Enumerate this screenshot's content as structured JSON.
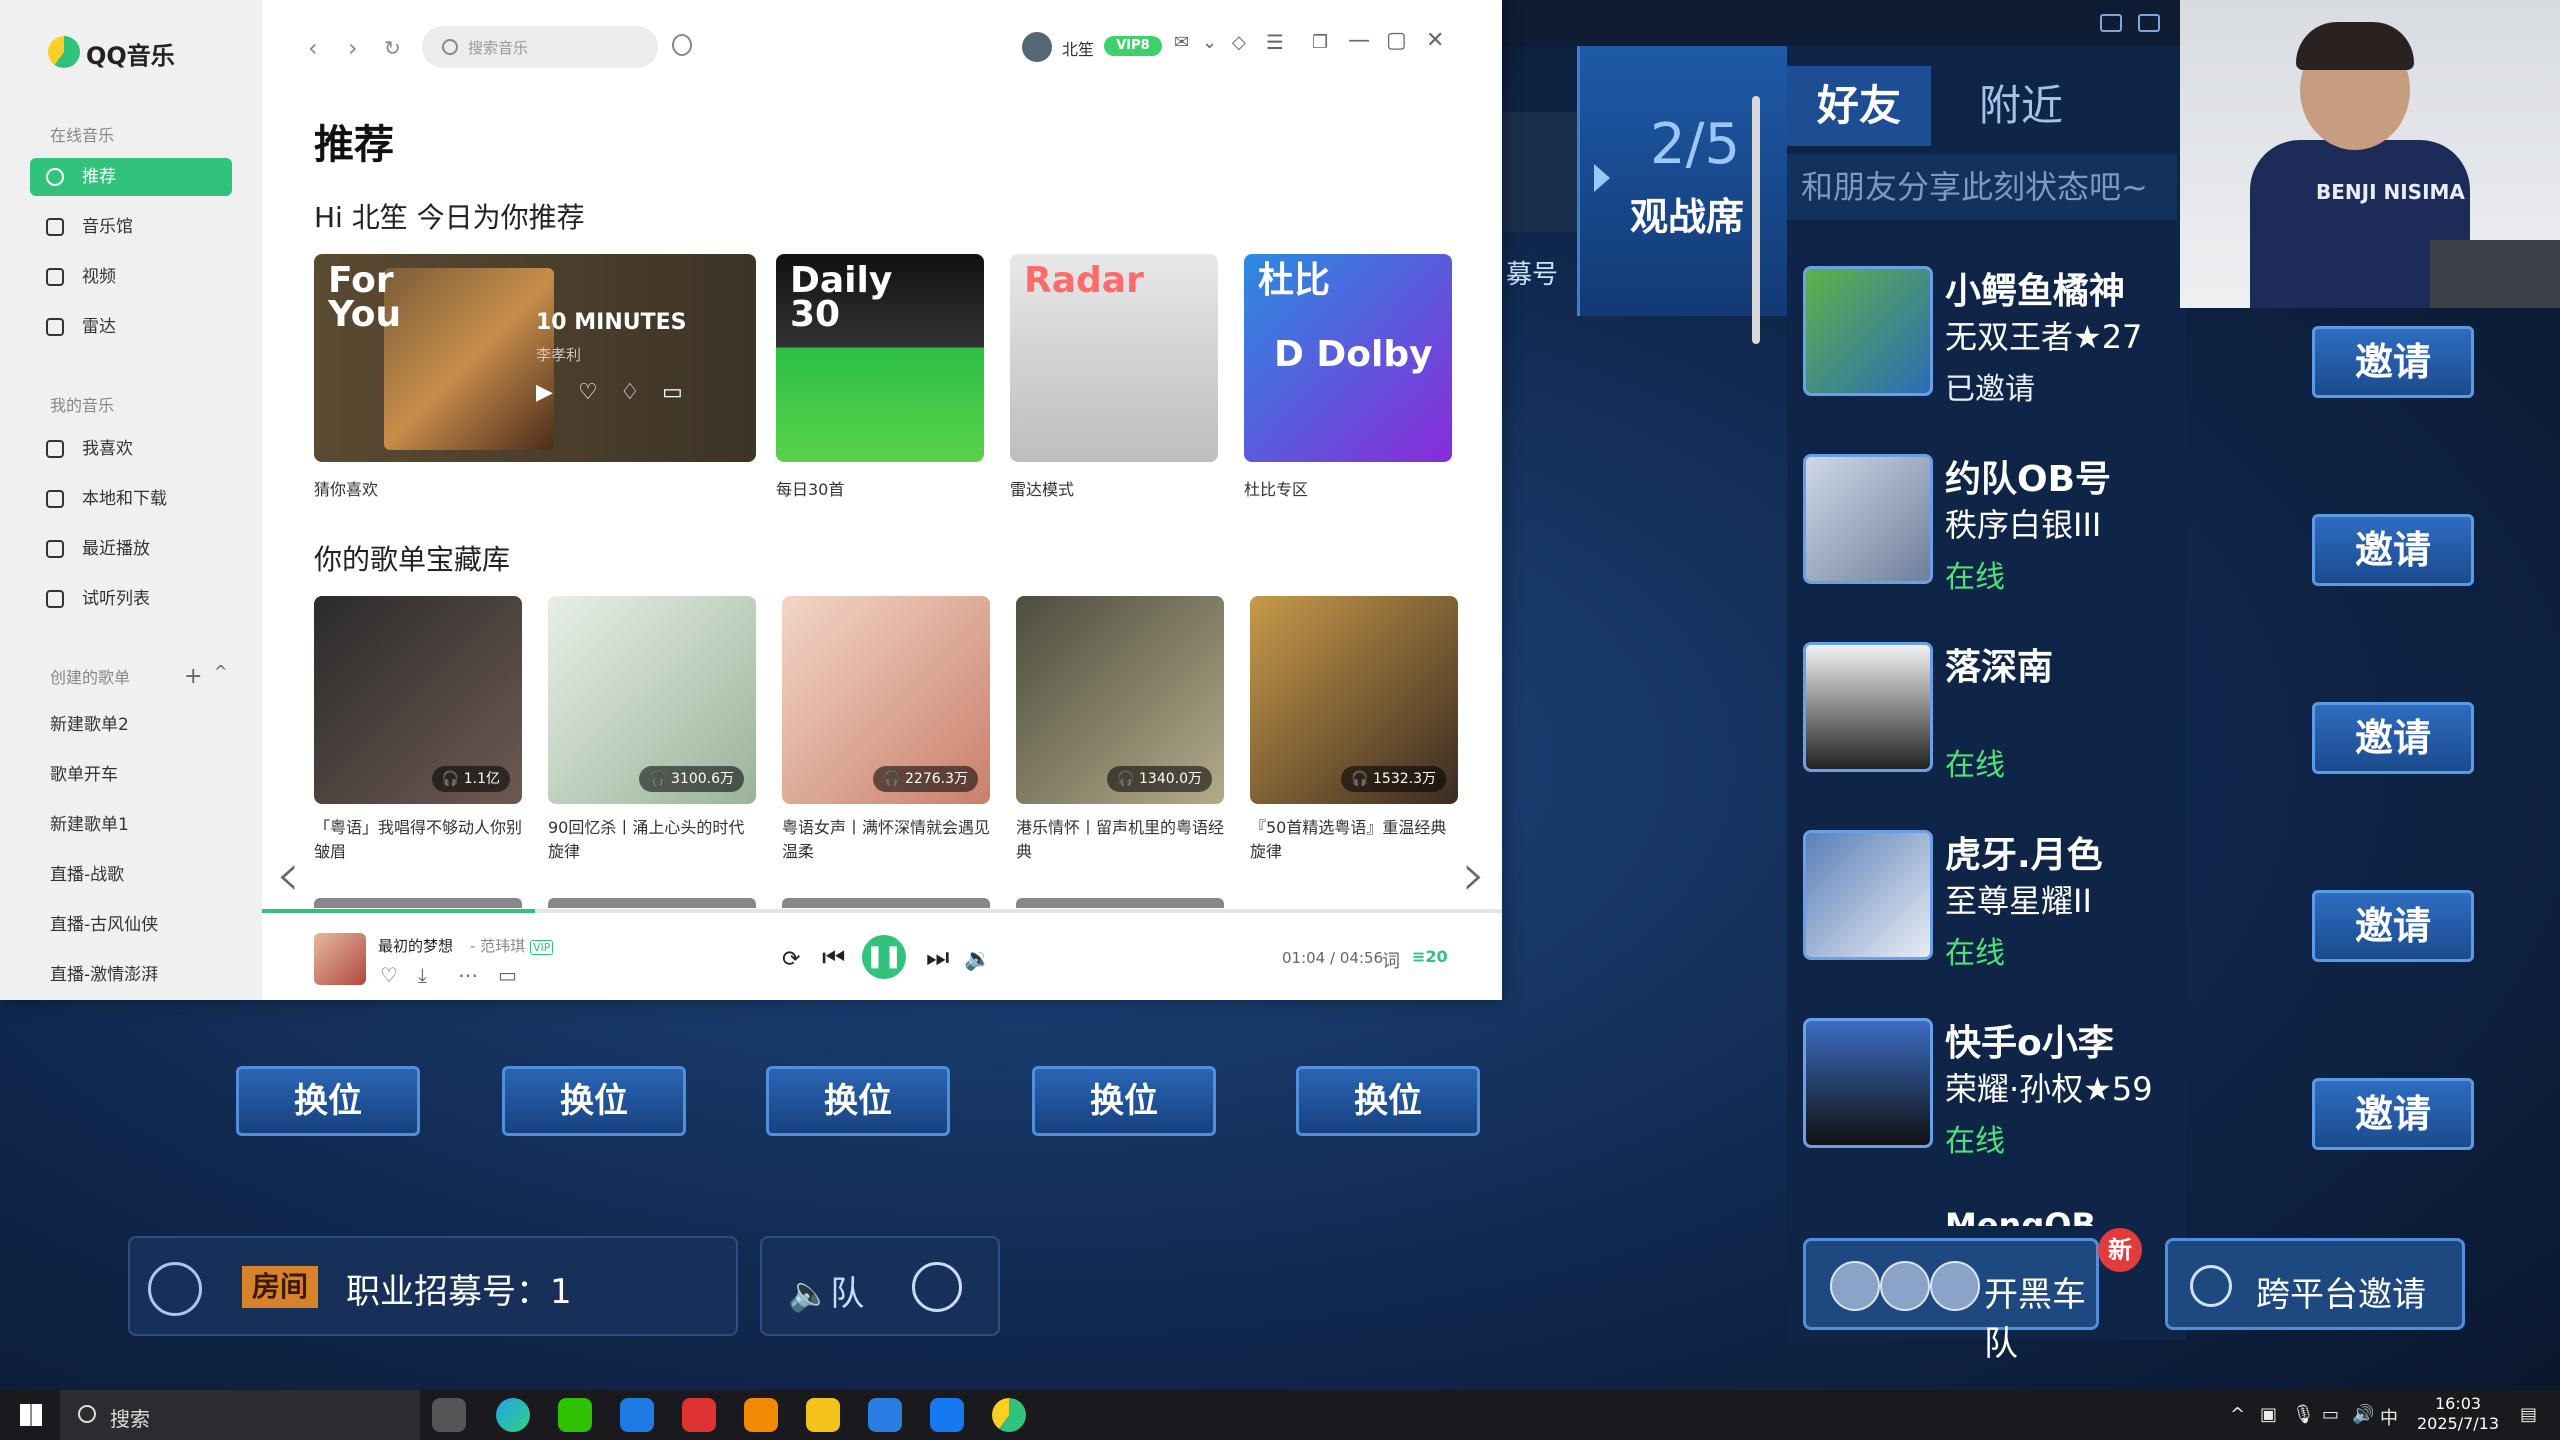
{
  "qq": {
    "app_name": "QQ音乐",
    "sidebar": {
      "online_section": "在线音乐",
      "online_items": [
        "推荐",
        "音乐馆",
        "视频",
        "雷达"
      ],
      "my_section": "我的音乐",
      "my_items": [
        "我喜欢",
        "本地和下载",
        "最近播放",
        "试听列表"
      ],
      "created_section": "创建的歌单",
      "created_add": "+",
      "created_collapse": "^",
      "playlists": [
        "新建歌单2",
        "歌单开车",
        "新建歌单1",
        "直播-战歌",
        "直播-古风仙侠",
        "直播-激情澎湃"
      ]
    },
    "toolbar": {
      "back": "‹",
      "forward": "›",
      "refresh": "↻",
      "search_placeholder": "搜索音乐",
      "user_name": "北笙",
      "vip_badge": "VIP8",
      "minimize": "—",
      "maximize": "▢",
      "close": "✕"
    },
    "page_title": "推荐",
    "greeting": "Hi 北笙 今日为你推荐",
    "cards": [
      {
        "label": "猜你喜欢",
        "big": "For You",
        "song": "10 MINUTES",
        "artist": "李孝利"
      },
      {
        "label": "每日30首",
        "big": "Daily 30"
      },
      {
        "label": "雷达模式",
        "big": "Radar"
      },
      {
        "label": "杜比专区",
        "big": "杜比",
        "logo": "D Dolby"
      }
    ],
    "section2_title": "你的歌单宝藏库",
    "playlists": [
      {
        "count": "1.1亿",
        "title": "「粤语」我唱得不够动人你别皱眉"
      },
      {
        "count": "3100.6万",
        "title": "90回忆杀丨涌上心头的时代旋律"
      },
      {
        "count": "2276.3万",
        "title": "粤语女声丨满怀深情就会遇见温柔"
      },
      {
        "count": "1340.0万",
        "title": "港乐情怀丨留声机里的粤语经典"
      },
      {
        "count": "1532.3万",
        "title": "『50首精选粤语』重温经典旋律"
      }
    ],
    "player": {
      "song": "最初的梦想",
      "artist": "- 范玮琪",
      "vip": "VIP",
      "time": "01:04 / 04:56",
      "lyric": "词",
      "queue": "20",
      "progress": 0.22
    }
  },
  "game": {
    "spectator_count": "2/5",
    "spectator_label": "观战席",
    "side_label": "募号",
    "swap_label": "换位",
    "room_tag": "房间",
    "recruit_text": "职业招募号：1",
    "team_label": "队",
    "friends": {
      "tabs": [
        "好友",
        "附近"
      ],
      "share_placeholder": "和朋友分享此刻状态吧~",
      "list": [
        {
          "name": "小鳄鱼橘神",
          "rank": "无双王者★27",
          "status": "已邀请",
          "status_type": "invited"
        },
        {
          "name": "约队OB号",
          "rank": "秩序白银III",
          "status": "在线",
          "status_type": "online"
        },
        {
          "name": "落深南",
          "rank": "",
          "status": "在线",
          "status_type": "online"
        },
        {
          "name": "虎牙.月色",
          "rank": "至尊星耀II",
          "status": "在线",
          "status_type": "online"
        },
        {
          "name": "快手o小李",
          "rank": "荣耀·孙权★59",
          "status": "在线",
          "status_type": "online"
        }
      ],
      "partial_name": "MengOB",
      "invite_label": "邀请"
    },
    "gang_button": "开黑车队",
    "new_badge": "新",
    "cross_platform": "跨平台邀请",
    "webcam_shirt": "BENJI NISIMA"
  },
  "taskbar": {
    "search": "搜索",
    "ime": "中",
    "time": "16:03",
    "date": "2025/7/13"
  },
  "colors": {
    "qq_green": "#31c27c",
    "game_blue": "#1d4880",
    "online_green": "#4ee07a"
  }
}
